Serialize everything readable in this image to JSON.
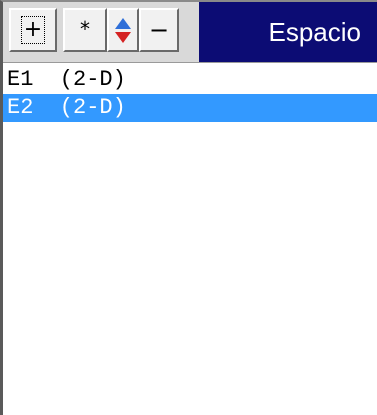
{
  "toolbar": {
    "add_label": "+",
    "star_label": "*",
    "move_up_icon": "arrow-up-icon",
    "move_down_icon": "arrow-down-icon",
    "remove_label": "−"
  },
  "title": "Espacio",
  "colors": {
    "title_bg": "#0c0c74",
    "selection_bg": "#3399ff",
    "arrow_up": "#2f6fd8",
    "arrow_down": "#d42222"
  },
  "list": {
    "items": [
      {
        "label": "E1  (2-D)",
        "selected": false
      },
      {
        "label": "E2  (2-D)",
        "selected": true
      }
    ]
  }
}
